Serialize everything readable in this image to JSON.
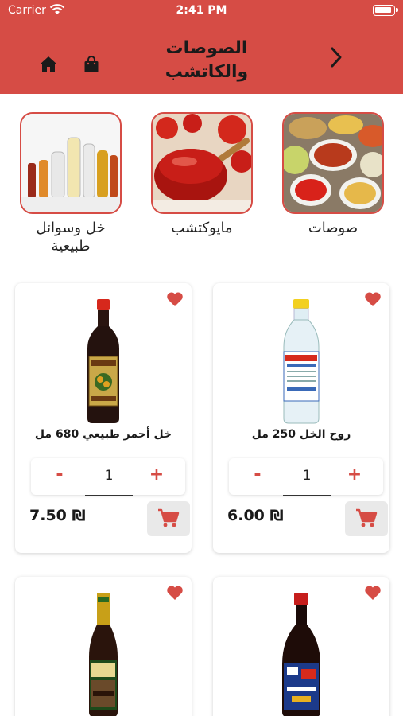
{
  "status_bar": {
    "carrier": "Carrier",
    "time": "2:41 PM"
  },
  "header": {
    "title_line1": "الصوصات",
    "title_line2": "والكاتشب",
    "back_icon": "chevron-right-icon",
    "home_icon": "home-icon",
    "bag_icon": "shopping-bag-icon",
    "background_color": "#d64c45"
  },
  "categories": [
    {
      "label": "صوصات"
    },
    {
      "label": "مايوكتشب"
    },
    {
      "label": "خل وسوائل طبيعية"
    }
  ],
  "products": [
    {
      "name": "روح الخل 250 مل",
      "quantity": "1",
      "minus": "-",
      "plus": "+",
      "price": "6.00 ₪"
    },
    {
      "name": "خل أحمر طبيعي 680 مل",
      "quantity": "1",
      "minus": "-",
      "plus": "+",
      "price": "7.50 ₪"
    },
    {
      "name": "",
      "quantity": "",
      "minus": "",
      "plus": "",
      "price": ""
    },
    {
      "name": "",
      "quantity": "",
      "minus": "",
      "plus": "",
      "price": ""
    }
  ],
  "colors": {
    "accent": "#d64c45",
    "cart_bg": "#e9e9e9"
  }
}
